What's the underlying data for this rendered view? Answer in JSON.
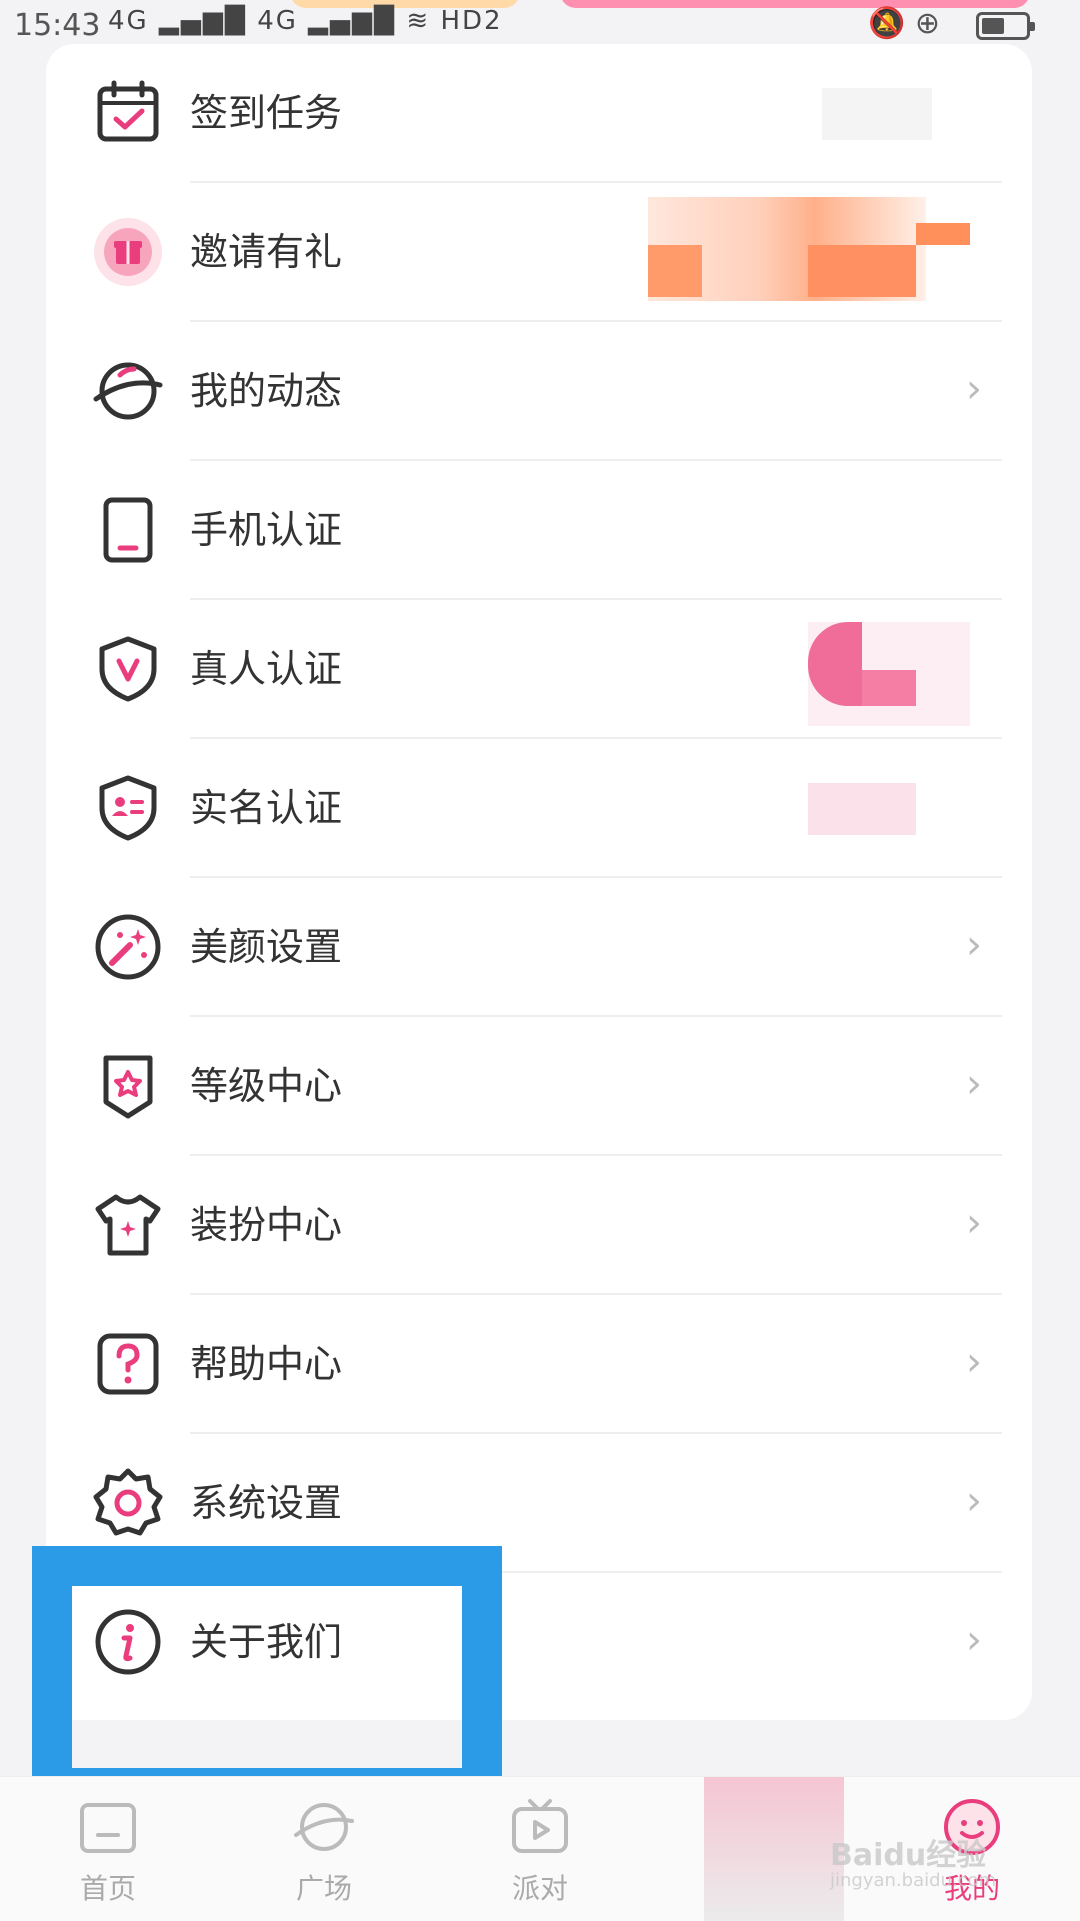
{
  "status_bar": {
    "time": "15:43",
    "signal": "4G ▂▄▆█ 4G ▂▄▆█ ≋ HD2",
    "right_icons": "🔕 ⊕"
  },
  "menu": {
    "items": [
      {
        "label": "签到任务",
        "icon": "calendar-check-icon"
      },
      {
        "label": "邀请有礼",
        "icon": "gift-icon"
      },
      {
        "label": "我的动态",
        "icon": "planet-icon",
        "arrow": "›"
      },
      {
        "label": "手机认证",
        "icon": "phone-icon"
      },
      {
        "label": "真人认证",
        "icon": "shield-v-icon"
      },
      {
        "label": "实名认证",
        "icon": "shield-id-icon"
      },
      {
        "label": "美颜设置",
        "icon": "magic-wand-icon",
        "arrow": "›"
      },
      {
        "label": "等级中心",
        "icon": "level-badge-icon",
        "arrow": "›"
      },
      {
        "label": "装扮中心",
        "icon": "outfit-icon",
        "arrow": "›"
      },
      {
        "label": "帮助中心",
        "icon": "help-icon",
        "arrow": "›"
      },
      {
        "label": "系统设置",
        "icon": "gear-icon",
        "arrow": "›"
      },
      {
        "label": "关于我们",
        "icon": "info-icon",
        "arrow": "›"
      }
    ]
  },
  "bottom_nav": {
    "items": [
      {
        "label": "首页",
        "icon": "home-icon"
      },
      {
        "label": "广场",
        "icon": "planet-icon"
      },
      {
        "label": "派对",
        "icon": "tv-play-icon"
      },
      {
        "label": "我的",
        "icon": "smiley-icon",
        "active": true
      }
    ]
  },
  "colors": {
    "accent": "#ea3d7e",
    "highlight": "#2b9be8",
    "icon_stroke": "#333333"
  },
  "watermark": {
    "brand": "Baidu经验",
    "url": "jingyan.baidu.com"
  }
}
